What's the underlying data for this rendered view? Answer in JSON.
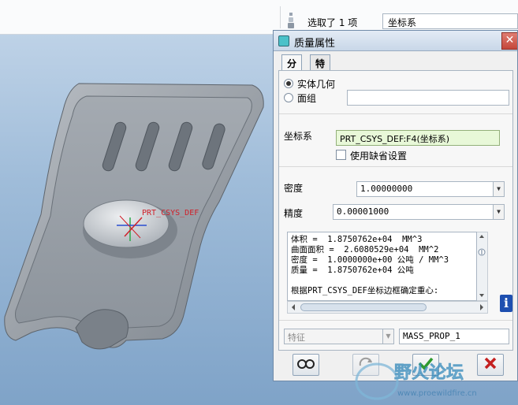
{
  "statusbar": {
    "selection_text": "选取了 1 项",
    "filter_value": "坐标系"
  },
  "viewport": {
    "csys_label": "PRT_CSYS_DEF"
  },
  "dialog": {
    "title": "质量属性",
    "close_glyph": "✕",
    "tabs": [
      {
        "label": "分析",
        "active": true
      },
      {
        "label": "特征",
        "active": false
      }
    ],
    "geometry_options": [
      {
        "label": "实体几何",
        "selected": true
      },
      {
        "label": "面组",
        "selected": false
      }
    ],
    "quilt_value": "",
    "csys": {
      "label": "坐标系",
      "value": "PRT_CSYS_DEF:F4(坐标系)",
      "use_default_label": "使用缺省设置",
      "use_default_checked": false
    },
    "density": {
      "label": "密度",
      "value": "1.00000000"
    },
    "accuracy": {
      "label": "精度",
      "value": "0.00001000"
    },
    "results_lines": [
      "体积 =  1.8750762e+04  MM^3",
      "曲面面积 =  2.6080529e+04  MM^2",
      "密度 =  1.0000000e+00 公吨 / MM^3",
      "质量 =  1.8750762e+04 公吨",
      "",
      "根据PRT_CSYS_DEF坐标边框确定重心:"
    ],
    "feature_placeholder": "特征",
    "feature_name": "MASS_PROP_1"
  },
  "icons": {
    "filter": "filter-icon",
    "info": "info-icon",
    "preview": "glasses-icon",
    "repeat": "repeat-icon",
    "ok": "checkmark-icon",
    "cancel": "cancel-icon"
  },
  "colors": {
    "titlebar": "#c8d7e8",
    "close": "#c4463a",
    "csys_field": "#e8f8d8",
    "ok": "#2f9a2f",
    "cancel": "#c42020",
    "csys_text": "#d0202a"
  },
  "watermark": {
    "title": "野火论坛",
    "url": "www.proewildfire.cn"
  }
}
